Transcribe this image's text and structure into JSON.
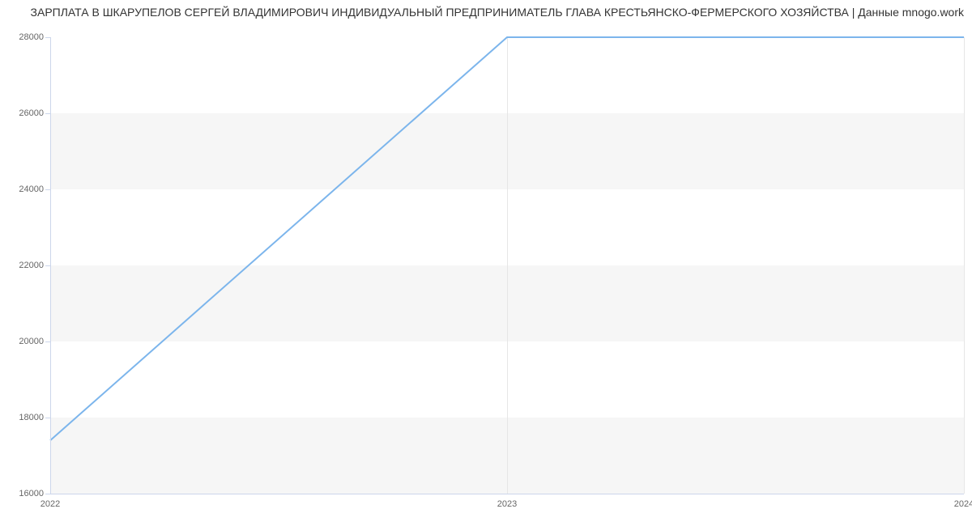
{
  "chart_data": {
    "type": "line",
    "title": "ЗАРПЛАТА В ШКАРУПЕЛОВ СЕРГЕЙ ВЛАДИМИРОВИЧ ИНДИВИДУАЛЬНЫЙ ПРЕДПРИНИМАТЕЛЬ ГЛАВА КРЕСТЬЯНСКО-ФЕРМЕРСКОГО ХОЗЯЙСТВА | Данные mnogo.work",
    "x": [
      2022,
      2023,
      2024
    ],
    "values": [
      17400,
      28000,
      28000
    ],
    "xlabel": "",
    "ylabel": "",
    "x_ticks": [
      2022,
      2023,
      2024
    ],
    "y_ticks": [
      16000,
      18000,
      20000,
      22000,
      24000,
      26000,
      28000
    ],
    "ylim": [
      16000,
      28000
    ],
    "xlim": [
      2022,
      2024
    ],
    "line_color": "#7cb5ec"
  }
}
